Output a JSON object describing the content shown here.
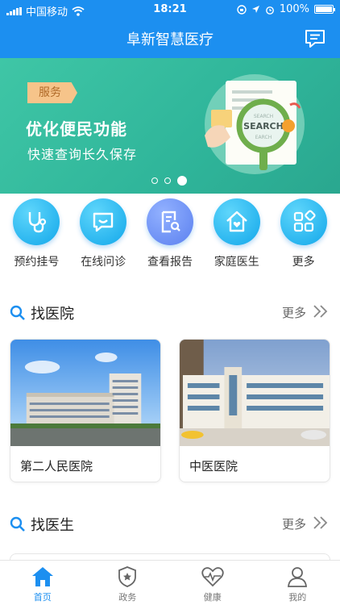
{
  "status_bar": {
    "carrier": "中国移动",
    "time": "18:21",
    "battery": "100%",
    "battery_level": 1.0
  },
  "nav": {
    "title": "阜新智慧医疗",
    "icon": "message-list-icon"
  },
  "banner": {
    "tag": "服务",
    "headline": "优化便民功能",
    "subline": "快速查询长久保存",
    "magnifier_text_top": "SEARCH",
    "magnifier_text_main": "SEARCH",
    "magnifier_text_bottom": "EARCH",
    "slide_count": 3,
    "active_slide": 3
  },
  "quick_menu": [
    {
      "label": "预约挂号",
      "icon": "stethoscope-icon",
      "color": "#22b8ef"
    },
    {
      "label": "在线问诊",
      "icon": "chat-consult-icon",
      "color": "#22b8ef"
    },
    {
      "label": "查看报告",
      "icon": "report-search-icon",
      "color": "#6a8ff5"
    },
    {
      "label": "家庭医生",
      "icon": "home-heart-icon",
      "color": "#22b8ef"
    },
    {
      "label": "更多",
      "icon": "grid-more-icon",
      "color": "#22b8ef"
    }
  ],
  "hospitals": {
    "title": "找医院",
    "more": "更多",
    "items": [
      {
        "name": "第二人民医院",
        "photo": "hospital-building-photo"
      },
      {
        "name": "中医医院",
        "photo": "hospital-building-photo"
      }
    ]
  },
  "doctors": {
    "title": "找医生",
    "more": "更多"
  },
  "tabs": [
    {
      "label": "首页",
      "icon": "home-icon",
      "active": true
    },
    {
      "label": "政务",
      "icon": "badge-star-icon",
      "active": false
    },
    {
      "label": "健康",
      "icon": "heart-pulse-icon",
      "active": false
    },
    {
      "label": "我的",
      "icon": "user-icon",
      "active": false
    }
  ],
  "colors": {
    "primary": "#1c8ff0",
    "banner": "#33b99c",
    "tag_bg": "#f6c48a"
  }
}
